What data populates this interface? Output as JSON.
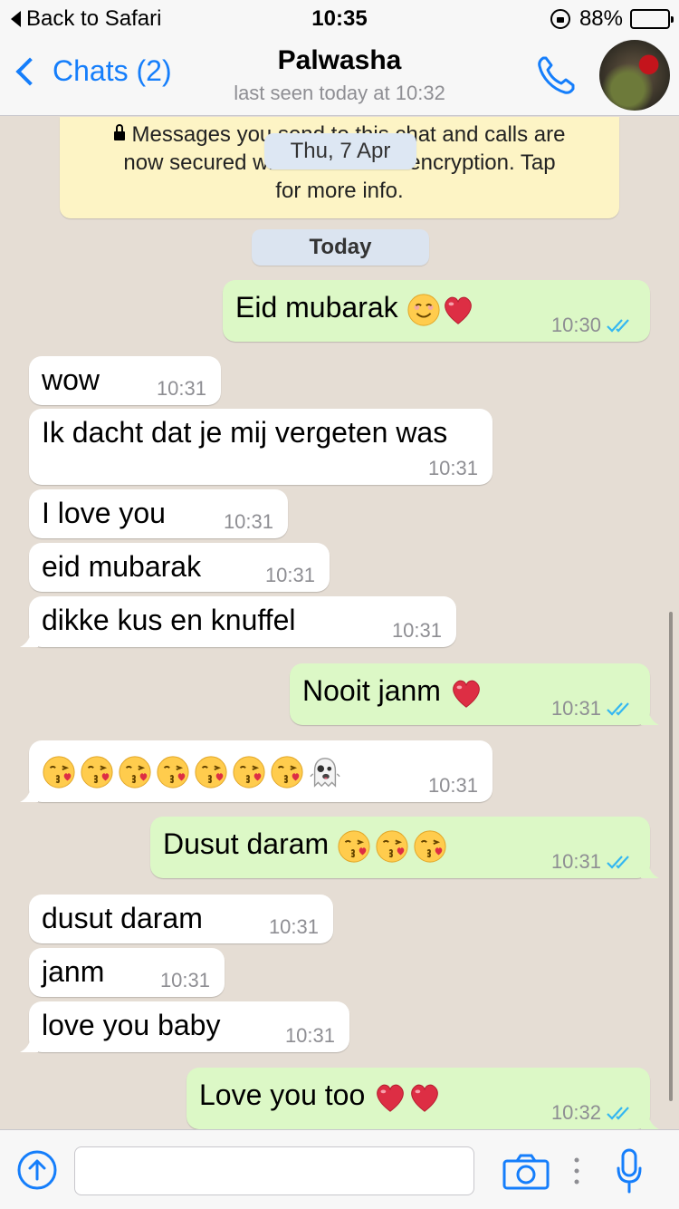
{
  "status_bar": {
    "back_label": "Back to Safari",
    "time": "10:35",
    "battery": "88%",
    "battery_level": 0.88
  },
  "nav": {
    "back_label": "Chats (2)",
    "contact_name": "Palwasha",
    "last_seen": "last seen today at 10:32"
  },
  "encryption_notice": {
    "line1": "Messages you send to this chat and calls are",
    "line2": "now secured with end-to-end encryption. Tap",
    "line3": "for more info."
  },
  "floating_date": "Thu, 7 Apr",
  "date_separator": "Today",
  "messages": [
    {
      "dir": "out",
      "text": "Eid mubarak",
      "emoji": [
        "smile-emoji",
        "heart-emoji"
      ],
      "time": "10:30",
      "read": true
    },
    {
      "dir": "in",
      "text": "wow",
      "time": "10:31"
    },
    {
      "dir": "in",
      "text": "Ik dacht dat je mij vergeten was",
      "time": "10:31"
    },
    {
      "dir": "in",
      "text": "I love you",
      "time": "10:31"
    },
    {
      "dir": "in",
      "text": "eid mubarak",
      "time": "10:31"
    },
    {
      "dir": "in",
      "text": "dikke kus en knuffel",
      "time": "10:31"
    },
    {
      "dir": "out",
      "text": "Nooit janm",
      "emoji": [
        "heart-emoji"
      ],
      "time": "10:31",
      "read": true
    },
    {
      "dir": "in",
      "text": "",
      "emoji": [
        "kiss-emoji",
        "kiss-emoji",
        "kiss-emoji",
        "kiss-emoji",
        "kiss-emoji",
        "kiss-emoji",
        "kiss-emoji",
        "ghost-emoji"
      ],
      "time": "10:31"
    },
    {
      "dir": "out",
      "text": "Dusut daram",
      "emoji": [
        "kiss-emoji",
        "kiss-emoji",
        "kiss-emoji"
      ],
      "time": "10:31",
      "read": true
    },
    {
      "dir": "in",
      "text": "dusut daram",
      "time": "10:31"
    },
    {
      "dir": "in",
      "text": "janm",
      "time": "10:31"
    },
    {
      "dir": "in",
      "text": "love you baby",
      "time": "10:31"
    },
    {
      "dir": "out",
      "text": "Love you too",
      "emoji": [
        "heart-emoji",
        "heart-emoji"
      ],
      "time": "10:32",
      "read": true
    }
  ],
  "colors": {
    "accent": "#157efb",
    "outgoing_bubble": "#dcf8c6",
    "incoming_bubble": "#ffffff",
    "read_ticks": "#34b7f1",
    "chat_background": "#e5ddd4",
    "banner": "#fdf4c5"
  }
}
